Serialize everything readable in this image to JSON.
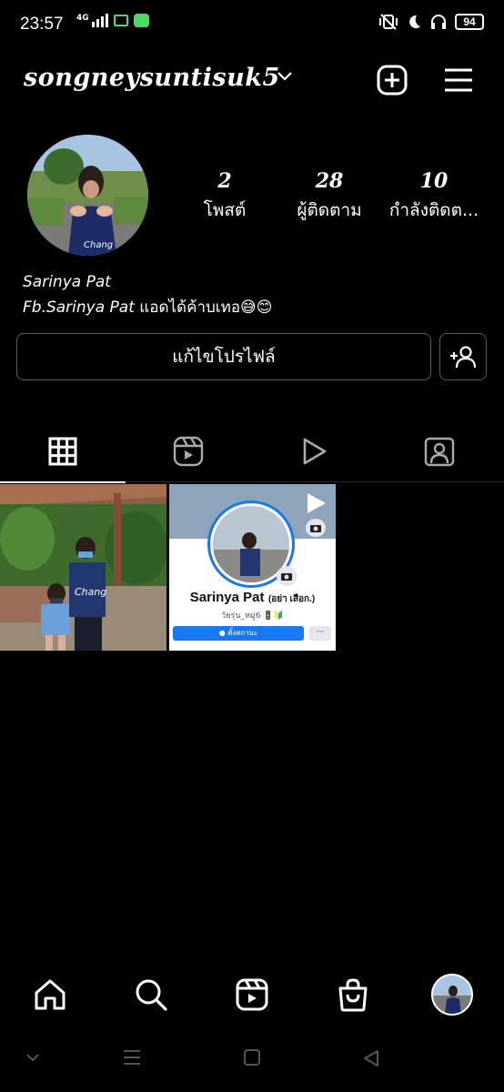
{
  "status_bar": {
    "time": "23:57",
    "network": "4G",
    "battery": "94"
  },
  "header": {
    "username": "songneysuntisuk5",
    "new_post_icon": "plus-square-icon",
    "menu_icon": "hamburger-menu-icon"
  },
  "profile": {
    "stats": [
      {
        "value": "2",
        "label": "โพสต์"
      },
      {
        "value": "28",
        "label": "ผู้ติดตาม"
      },
      {
        "value": "10",
        "label": "กำลังติดต..."
      }
    ],
    "bio_name": "Sarinya Pat",
    "bio_fb": "Fb.Sarinya Pat",
    "bio_text": " แอดได้ค้าบเทอ😅😊",
    "edit_button": "แก้ไขโปรไฟล์"
  },
  "tabs": [
    {
      "icon": "grid-icon",
      "active": true
    },
    {
      "icon": "reels-icon",
      "active": false
    },
    {
      "icon": "video-play-icon",
      "active": false
    },
    {
      "icon": "tagged-person-icon",
      "active": false
    }
  ],
  "posts": [
    {
      "type": "photo"
    },
    {
      "type": "reel",
      "name": "Sarinya Pat",
      "name_suffix": "(อย่า เสือก.)",
      "sub": "วัยรุ่น_หมู่6 🚦🔰",
      "btn": "ตั้งสถานะ",
      "more": "···"
    }
  ],
  "bottom_nav": [
    "home-icon",
    "search-icon",
    "reels-icon",
    "shop-icon",
    "profile-avatar"
  ],
  "colors": {
    "background": "#000000",
    "border": "#5a5a5a",
    "fb_blue": "#1877f2"
  }
}
